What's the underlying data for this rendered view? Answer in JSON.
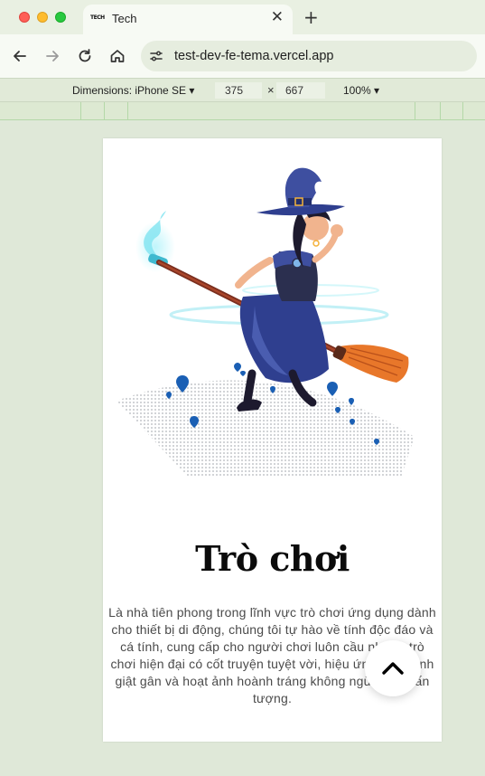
{
  "browser": {
    "tab": {
      "favicon_text": "TECH",
      "title": "Tech",
      "close_label": "✕"
    },
    "new_tab_label": "+",
    "url": "test-dev-fe-tema.vercel.app"
  },
  "devtools": {
    "dimensions_label": "Dimensions: iPhone SE ▾",
    "width": "375",
    "times": "×",
    "height": "667",
    "zoom": "100% ▾"
  },
  "page": {
    "heading": "Trò chơi",
    "description": "Là nhà tiên phong trong lĩnh vực trò chơi ứng dụng dành cho thiết bị di động, chúng tôi tự hào về tính độc đáo và cá tính, cung cấp cho người chơi luôn cầu những trò chơi hiện đại có cốt truyện tuyệt vời, hiệu ứng âm thanh giật gân và hoạt ảnh hoành tráng không ngừng gây ấn tượng."
  },
  "icons": {
    "back": "arrow-left-icon",
    "forward": "arrow-right-icon",
    "reload": "reload-icon",
    "home": "home-icon",
    "site_info": "tune-icon",
    "scroll_top": "chevron-up-icon"
  },
  "colors": {
    "witch_dress": "#2f3f8f",
    "broom_bristles": "#e8772a",
    "map_dots": "#9aa0a6",
    "map_pins": "#1a5fb4",
    "magic_glow": "#7fe3f0"
  }
}
